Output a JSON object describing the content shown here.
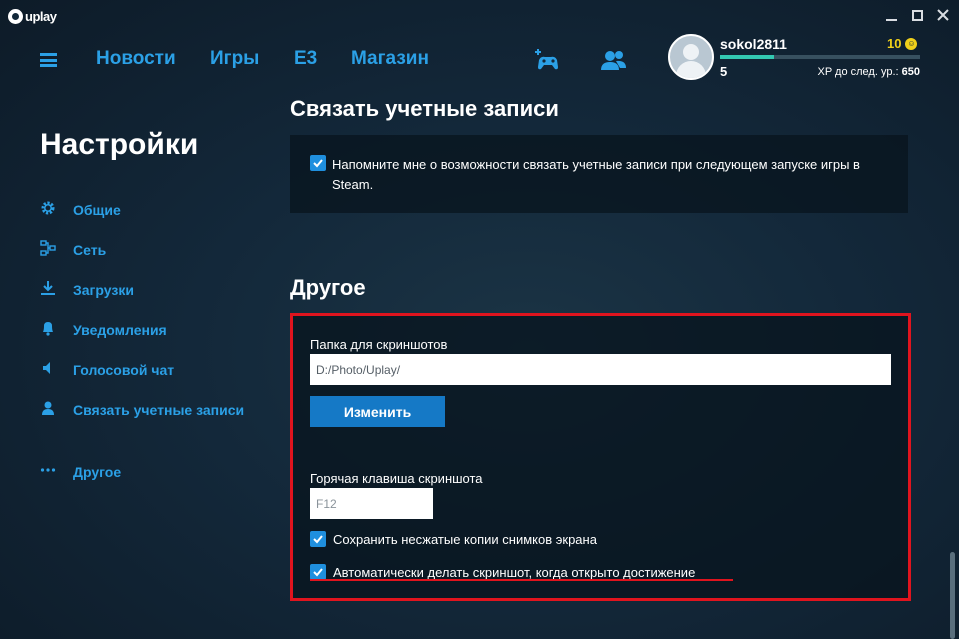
{
  "app": {
    "logo_text": "uplay"
  },
  "nav": {
    "items": [
      "Новости",
      "Игры",
      "E3",
      "Магазин"
    ]
  },
  "profile": {
    "username": "sokol2811",
    "units": "10",
    "level": "5",
    "xp_label": "XP до след. ур.:",
    "xp_value": "650",
    "xp_progress": 0.27
  },
  "sidebar": {
    "title": "Настройки",
    "items": [
      {
        "label": "Общие",
        "icon": "gear-icon"
      },
      {
        "label": "Сеть",
        "icon": "network-icon"
      },
      {
        "label": "Загрузки",
        "icon": "download-icon"
      },
      {
        "label": "Уведомления",
        "icon": "bell-icon"
      },
      {
        "label": "Голосовой чат",
        "icon": "speaker-icon"
      },
      {
        "label": "Связать учетные записи",
        "icon": "user-icon"
      },
      {
        "label": "Другое",
        "icon": "dots-icon"
      }
    ]
  },
  "link_accounts": {
    "heading": "Связать учетные записи",
    "remind_checked": true,
    "remind_label": "Напомните мне о возможности связать учетные записи при следующем запуске игры в Steam."
  },
  "other": {
    "heading": "Другое",
    "screenshot_folder_label": "Папка для скриншотов",
    "screenshot_folder_value": "D:/Photo/Uplay/",
    "change_button": "Изменить",
    "hotkey_label": "Горячая клавиша скриншота",
    "hotkey_value": "F12",
    "save_uncompressed_checked": true,
    "save_uncompressed_label": "Сохранить несжатые копии снимков экрана",
    "auto_screenshot_checked": true,
    "auto_screenshot_label": "Автоматически делать скриншот, когда открыто достижение"
  },
  "colors": {
    "accent": "#2ba0e6",
    "highlight": "#e0141e",
    "units": "#f0d01a",
    "xp_bar": "#33c9b2"
  }
}
